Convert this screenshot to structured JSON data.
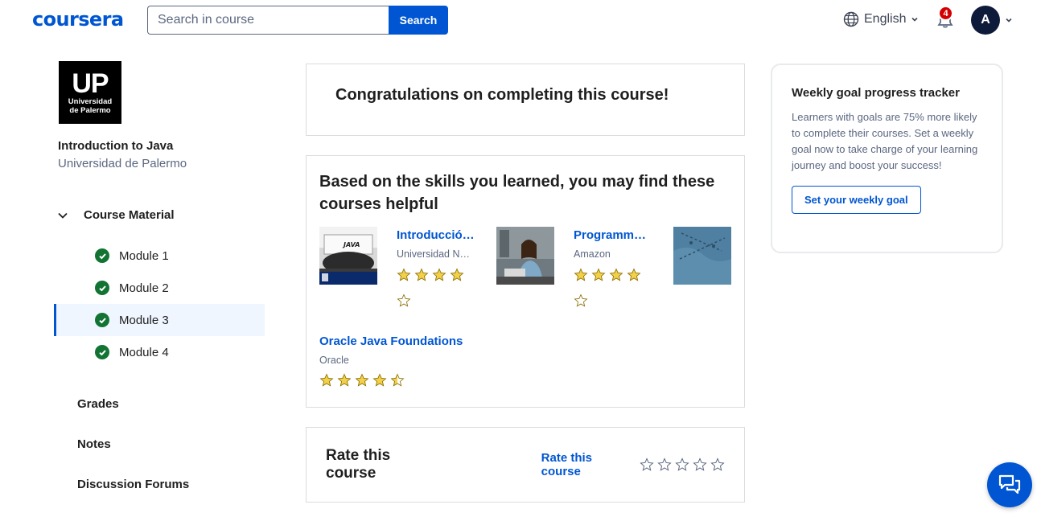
{
  "header": {
    "logo": "coursera",
    "search_placeholder": "Search in course",
    "search_button": "Search",
    "language": "English",
    "notification_count": "4",
    "avatar_initial": "A"
  },
  "sidebar": {
    "university_logo_big": "UP",
    "university_logo_line1": "Universidad",
    "university_logo_line2": "de Palermo",
    "course_title": "Introduction to Java",
    "course_partner": "Universidad de Palermo",
    "material_label": "Course Material",
    "modules": [
      {
        "label": "Module 1",
        "completed": true
      },
      {
        "label": "Module 2",
        "completed": true
      },
      {
        "label": "Module 3",
        "completed": true,
        "active": true
      },
      {
        "label": "Module 4",
        "completed": true
      }
    ],
    "links": [
      "Grades",
      "Notes",
      "Discussion Forums"
    ]
  },
  "main": {
    "congrats": "Congratulations on completing this course!",
    "recommend_title": "Based on the skills you learned, you may find these courses helpful",
    "recommendations": [
      {
        "name": "Introducción a Java",
        "partner": "Universidad Nacional Autónoma de México",
        "rating": 4,
        "thumb_text": "JAVA"
      },
      {
        "name": "Programming with Java",
        "partner": "Amazon",
        "rating": 4
      },
      {
        "name": "",
        "partner": "",
        "rating": null
      },
      {
        "name": "Oracle Java Foundations",
        "partner": "Oracle",
        "rating": 4.5
      }
    ],
    "rate_title": "Rate this course",
    "rate_link": "Rate this course"
  },
  "goal": {
    "title": "Weekly goal progress tracker",
    "text": "Learners with goals are 75% more likely to complete their courses. Set a weekly goal now to take charge of your learning journey and boost your success!",
    "button": "Set your weekly goal"
  },
  "colors": {
    "brand": "#0056d2",
    "success": "#137333",
    "star": "#f2d049",
    "badge": "#d30001"
  }
}
